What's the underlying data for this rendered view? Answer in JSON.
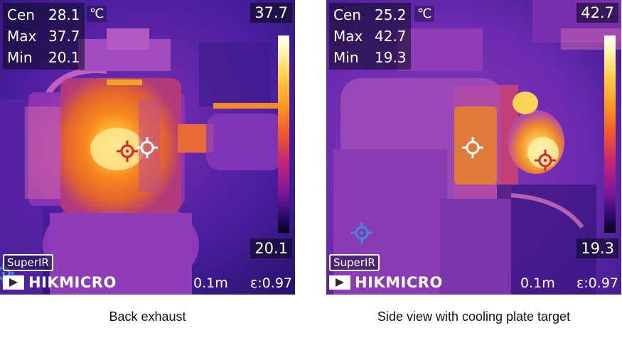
{
  "images": [
    {
      "readout": {
        "cen_label": "Cen",
        "cen_value": "28.1",
        "max_label": "Max",
        "max_value": "37.7",
        "min_label": "Min",
        "min_value": "20.1",
        "unit": "℃"
      },
      "scale": {
        "top": "37.7",
        "bottom": "20.1"
      },
      "badge": "SuperIR",
      "brand": "HIKMICRO",
      "distance": "0.1m",
      "emissivity": "ε:0.97",
      "caption": "Back exhaust"
    },
    {
      "readout": {
        "cen_label": "Cen",
        "cen_value": "25.2",
        "max_label": "Max",
        "max_value": "42.7",
        "min_label": "Min",
        "min_value": "19.3",
        "unit": "℃"
      },
      "scale": {
        "top": "42.7",
        "bottom": "19.3"
      },
      "badge": "SuperIR",
      "brand": "HIKMICRO",
      "distance": "0.1m",
      "emissivity": "ε:0.97",
      "caption": "Side view with cooling plate target"
    }
  ],
  "colors": {
    "max_marker": "#e0202a",
    "center_marker": "#ffffff",
    "min_marker": "#3a8ee8",
    "palette_cold": "#2a0a6a",
    "palette_hot": "#fff6b0"
  }
}
